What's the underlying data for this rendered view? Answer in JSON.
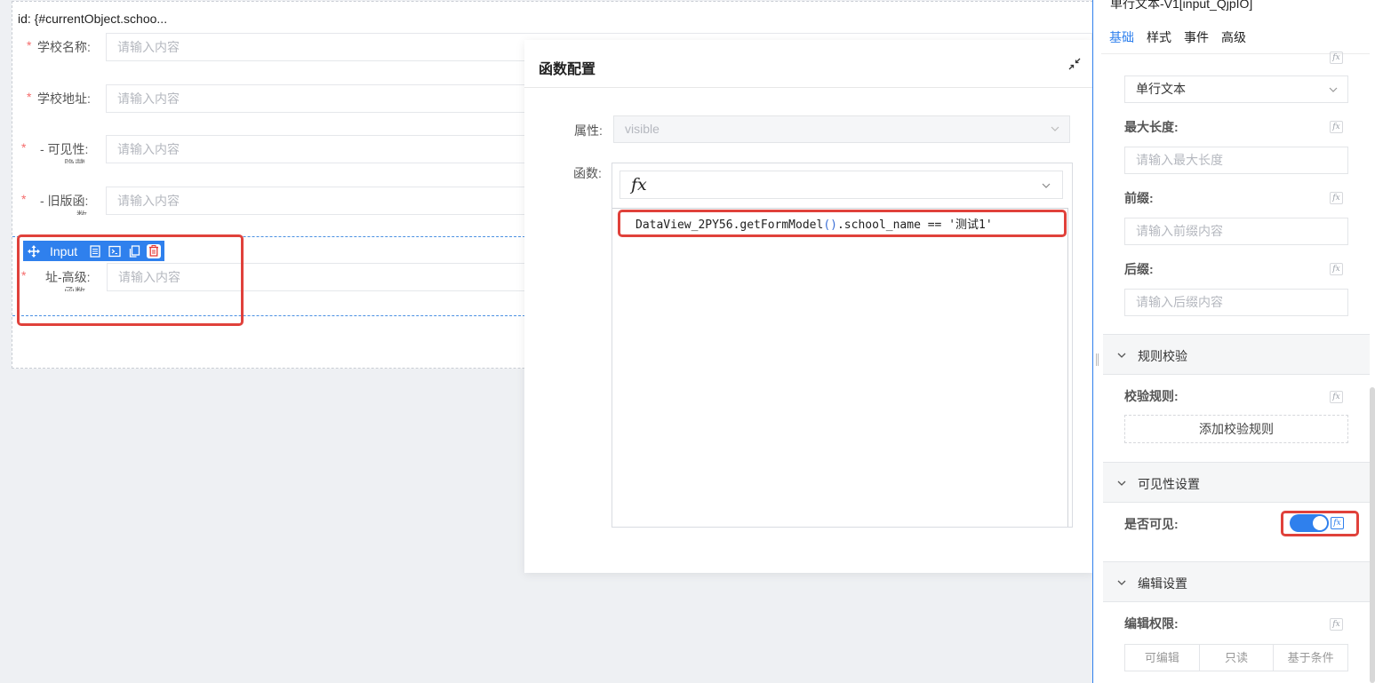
{
  "form": {
    "id_label": "id: {#currentObject.schoo...",
    "placeholder": "请输入内容",
    "rows": [
      {
        "label": "学校名称:",
        "sub": ""
      },
      {
        "label": "学校地址:",
        "sub": ""
      },
      {
        "label": "- 可见性:",
        "sub": "隐藏"
      },
      {
        "label": "- 旧版函:",
        "sub": "数"
      }
    ],
    "selected_row": {
      "label": "址-高级:",
      "sub": "函数"
    },
    "required_mark": "*",
    "toolbar_label": "Input"
  },
  "dialog": {
    "title": "函数配置",
    "property_label": "属性:",
    "property_value": "visible",
    "function_label": "函数:",
    "fx_symbol": "fx",
    "code_prefix": "DataView_2PY56.getFormModel",
    "code_parens": "()",
    "code_suffix": ".school_name == '测试1'"
  },
  "panel": {
    "component_title": "单行文本-V1[input_QjpIO]",
    "tabs": [
      "基础",
      "样式",
      "事件",
      "高级"
    ],
    "active_tab": "基础",
    "type_value": "单行文本",
    "max_length_label": "最大长度:",
    "max_length_placeholder": "请输入最大长度",
    "prefix_label": "前缀:",
    "prefix_placeholder": "请输入前缀内容",
    "suffix_label": "后缀:",
    "suffix_placeholder": "请输入后缀内容",
    "rules_section": "规则校验",
    "rules_label": "校验规则:",
    "add_rule_button": "添加校验规则",
    "visibility_section": "可见性设置",
    "visible_label": "是否可见:",
    "visible_on": true,
    "edit_section": "编辑设置",
    "edit_perm_label": "编辑权限:",
    "edit_options": [
      "可编辑",
      "只读",
      "基于条件"
    ]
  },
  "colors": {
    "accent": "#2f80ed",
    "highlight": "#e0413b",
    "required": "#f56c6c"
  }
}
